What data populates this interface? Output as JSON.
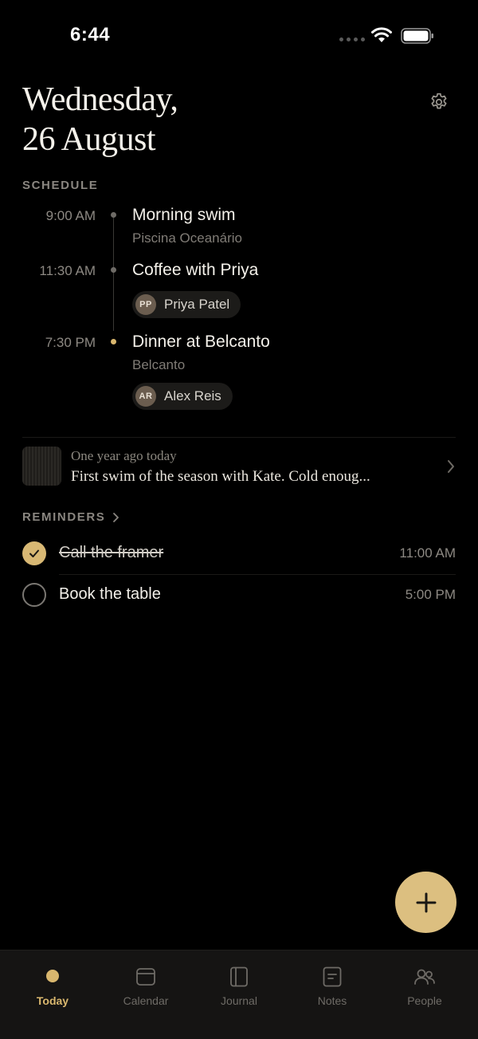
{
  "status_bar": {
    "time": "6:44"
  },
  "header": {
    "date_line1": "Wednesday,",
    "date_line2": "26 August"
  },
  "schedule": {
    "label": "SCHEDULE",
    "events": [
      {
        "time": "9:00 AM",
        "title": "Morning swim",
        "subtitle": "Piscina Oceanário"
      },
      {
        "time": "11:30 AM",
        "title": "Coffee with Priya",
        "person": {
          "initials": "PP",
          "name": "Priya Patel"
        }
      },
      {
        "time": "7:30 PM",
        "title": "Dinner at Belcanto",
        "subtitle": "Belcanto",
        "person": {
          "initials": "AR",
          "name": "Alex Reis"
        }
      }
    ]
  },
  "memory": {
    "kicker": "One year ago today",
    "text": "First swim of the season with Kate. Cold enoug..."
  },
  "reminders": {
    "label": "REMINDERS",
    "items": [
      {
        "title": "Call the framer",
        "time": "11:00 AM",
        "done": true
      },
      {
        "title": "Book the table",
        "time": "5:00 PM",
        "done": false
      }
    ]
  },
  "tabs": [
    {
      "label": "Today",
      "active": true
    },
    {
      "label": "Calendar",
      "active": false
    },
    {
      "label": "Journal",
      "active": false
    },
    {
      "label": "Notes",
      "active": false
    },
    {
      "label": "People",
      "active": false
    }
  ],
  "colors": {
    "accent": "#d9b76e",
    "background": "#000000",
    "tab_bar": "#151413"
  }
}
